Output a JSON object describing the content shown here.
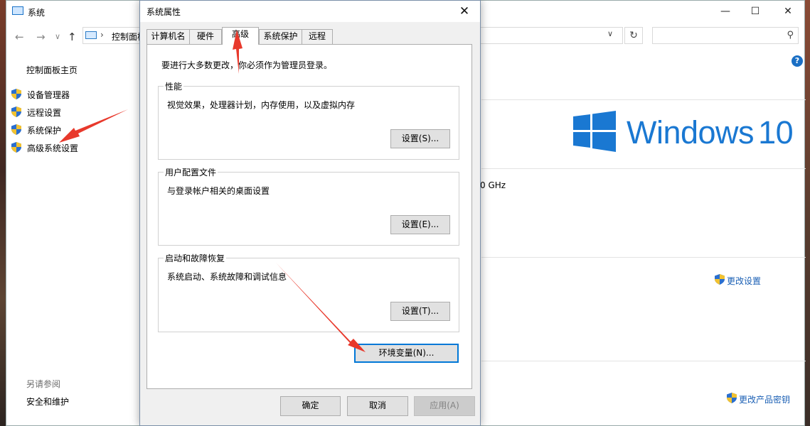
{
  "system_window": {
    "title": "系统",
    "address": {
      "breadcrumb": "控制面板"
    },
    "left_nav": {
      "home": "控制面板主页",
      "items": [
        {
          "label": "设备管理器"
        },
        {
          "label": "远程设置"
        },
        {
          "label": "系统保护"
        },
        {
          "label": "高级系统设置"
        }
      ],
      "see_also_title": "另请参阅",
      "see_also_items": [
        {
          "label": "安全和维护"
        }
      ]
    },
    "windows_brand": "Windows",
    "windows_version": "10",
    "cpu_speed_fragment": "0 GHz",
    "change_settings_link": "更改设置",
    "change_product_key_link": "更改产品密钥"
  },
  "dialog": {
    "title": "系统属性",
    "tabs": [
      {
        "label": "计算机名"
      },
      {
        "label": "硬件"
      },
      {
        "label": "高级",
        "active": true
      },
      {
        "label": "系统保护"
      },
      {
        "label": "远程"
      }
    ],
    "admin_note": "要进行大多数更改，你必须作为管理员登录。",
    "groups": [
      {
        "title": "性能",
        "description": "视觉效果，处理器计划，内存使用，以及虚拟内存",
        "button": "设置(S)..."
      },
      {
        "title": "用户配置文件",
        "description": "与登录帐户相关的桌面设置",
        "button": "设置(E)..."
      },
      {
        "title": "启动和故障恢复",
        "description": "系统启动、系统故障和调试信息",
        "button": "设置(T)..."
      }
    ],
    "env_button": "环境变量(N)...",
    "ok_button": "确定",
    "cancel_button": "取消",
    "apply_button": "应用(A)"
  },
  "colors": {
    "accent": "#0078d7",
    "brand_blue": "#1a78d2",
    "annotation_red": "#e8392c"
  }
}
